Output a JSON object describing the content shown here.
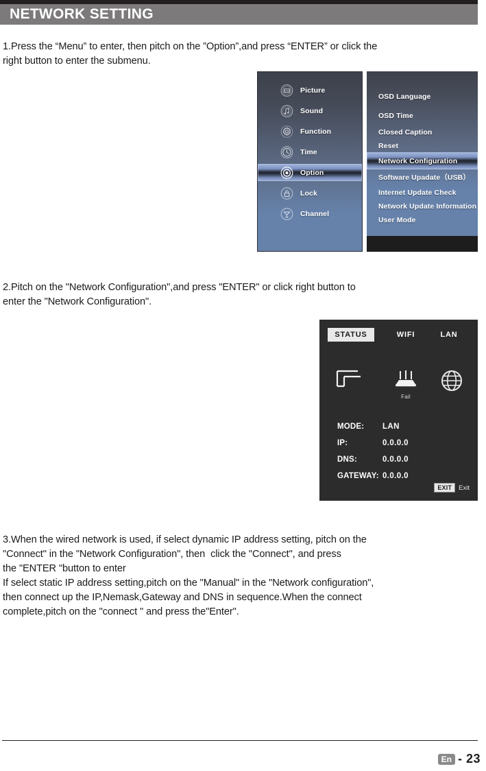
{
  "header": {
    "title": "NETWORK SETTING"
  },
  "steps": {
    "step1": "1.Press the “Menu” to enter, then pitch on the ”Option”,and press “ENTER” or click the\nright button to enter the submenu.",
    "step2": "2.Pitch on the \"Network Configuration\",and press \"ENTER\" or click right button to\nenter the \"Network Configuration\".",
    "step3": "3.When the wired network is used, if select dynamic IP address setting, pitch on the\n\"Connect\" in the \"Network Configuration\", then  click the \"Connect\", and press\nthe \"ENTER \"button to enter\nIf select static IP address setting,pitch on the \"Manual\" in the \"Network configuration\",\nthen connect up the IP,Nemask,Gateway and DNS in sequence.When the connect\ncomplete,pitch on the \"connect \" and press the\"Enter\"."
  },
  "osd_menu": {
    "main_items": [
      {
        "label": "Picture",
        "icon": "picture-icon",
        "selected": false
      },
      {
        "label": "Sound",
        "icon": "sound-icon",
        "selected": false
      },
      {
        "label": "Function",
        "icon": "gear-icon",
        "selected": false
      },
      {
        "label": "Time",
        "icon": "clock-icon",
        "selected": false
      },
      {
        "label": "Option",
        "icon": "option-icon",
        "selected": true
      },
      {
        "label": "Lock",
        "icon": "lock-icon",
        "selected": false
      },
      {
        "label": "Channel",
        "icon": "antenna-icon",
        "selected": false
      }
    ],
    "sub_items": [
      {
        "label": "OSD Language",
        "selected": false
      },
      {
        "label": "OSD Time",
        "selected": false
      },
      {
        "label": "Closed Caption",
        "selected": false
      },
      {
        "label": "Reset",
        "selected": false
      },
      {
        "label": "Network Configuration",
        "selected": true
      },
      {
        "label": "Software Upadate（USB）",
        "selected": false
      },
      {
        "label": "Internet Update Check",
        "selected": false
      },
      {
        "label": "Network Update Information",
        "selected": false
      },
      {
        "label": "User Mode",
        "selected": false
      }
    ]
  },
  "network_status": {
    "tabs": [
      {
        "label": "STATUS",
        "active": true
      },
      {
        "label": "WIFI",
        "active": false
      },
      {
        "label": "LAN",
        "active": false
      }
    ],
    "icons": [
      {
        "name": "lan-cable-icon",
        "label": ""
      },
      {
        "name": "wifi-router-icon",
        "label": "Fail"
      },
      {
        "name": "globe-icon",
        "label": ""
      }
    ],
    "fields": [
      {
        "key": "MODE:",
        "value": "LAN"
      },
      {
        "key": "IP:",
        "value": "0.0.0.0"
      },
      {
        "key": "DNS:",
        "value": "0.0.0.0"
      },
      {
        "key": "GATEWAY:",
        "value": "0.0.0.0"
      }
    ],
    "exit": {
      "key": "EXIT",
      "label": "Exit"
    }
  },
  "footer": {
    "language": "En",
    "page": "- 23"
  },
  "colors": {
    "header_bar": "#7c7a7b",
    "rule": "#231f20",
    "osd_panel_top": "#3d414b",
    "osd_panel_bottom": "#6682ab",
    "osd_highlight": "#a8bae1",
    "status_bg": "#2c2c2c",
    "status_tab_active_bg": "#e8e8e8"
  }
}
